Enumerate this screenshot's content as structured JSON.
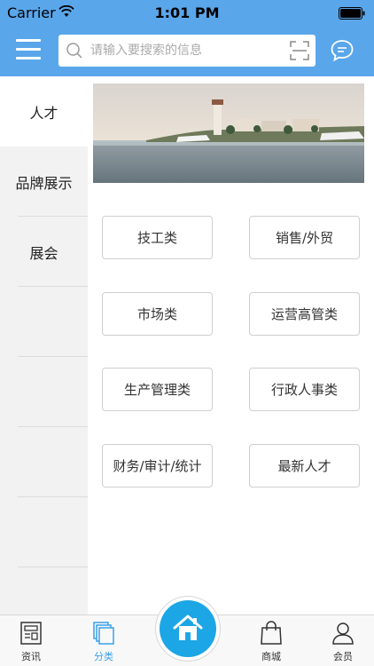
{
  "status_bar": {
    "carrier": "Carrier",
    "time": "1:01 PM"
  },
  "header": {
    "search_placeholder": "请输入要搜索的信息"
  },
  "sidebar": {
    "items": [
      {
        "label": "人才",
        "active": true
      },
      {
        "label": "品牌展示",
        "active": false
      },
      {
        "label": "展会",
        "active": false
      },
      {
        "label": "",
        "active": false
      },
      {
        "label": "",
        "active": false
      },
      {
        "label": "",
        "active": false
      },
      {
        "label": "",
        "active": false
      }
    ]
  },
  "categories": [
    {
      "label": "技工类"
    },
    {
      "label": "销售/外贸"
    },
    {
      "label": "市场类"
    },
    {
      "label": "运营高管类"
    },
    {
      "label": "生产管理类"
    },
    {
      "label": "行政人事类"
    },
    {
      "label": "财务/审计/统计"
    },
    {
      "label": "最新人才"
    }
  ],
  "tab_bar": {
    "tabs": [
      {
        "label": "资讯",
        "icon": "news-icon",
        "active": false
      },
      {
        "label": "分类",
        "icon": "category-icon",
        "active": true
      },
      {
        "label": "商城",
        "icon": "shopping-bag-icon",
        "active": false
      },
      {
        "label": "会员",
        "icon": "user-icon",
        "active": false
      }
    ],
    "home_icon": "home-icon"
  },
  "colors": {
    "header": "#5aa6ea",
    "accent": "#1ca6e5",
    "active_tab": "#3aa0e8"
  }
}
